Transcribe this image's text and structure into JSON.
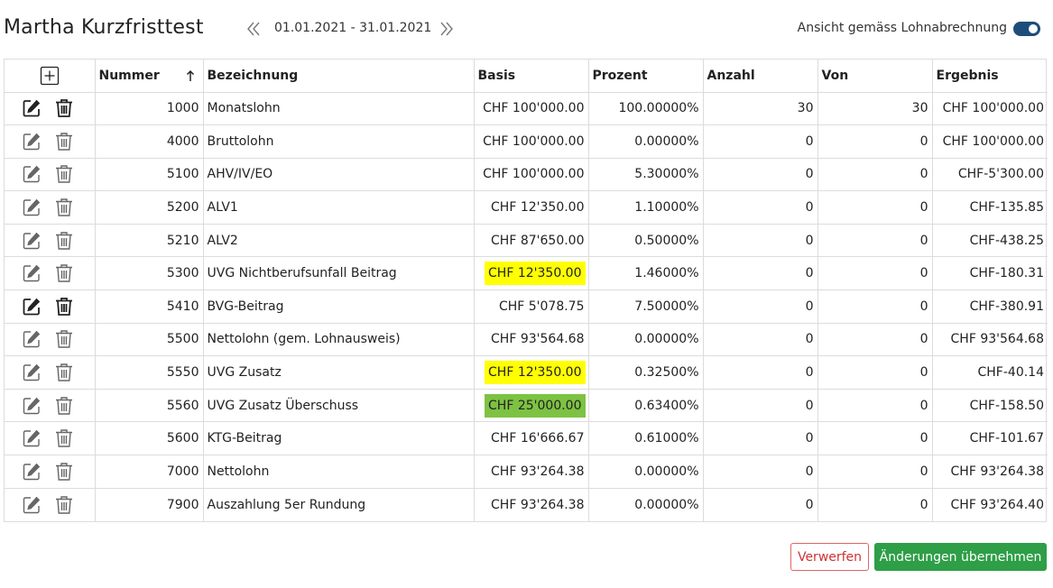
{
  "header": {
    "title": "Martha Kurzfristtest",
    "date_range": "01.01.2021 - 31.01.2021",
    "toggle_label": "Ansicht gemäss Lohnabrechnung",
    "toggle_on": true
  },
  "table": {
    "columns": {
      "nummer": "Nummer",
      "bezeichnung": "Bezeichnung",
      "basis": "Basis",
      "prozent": "Prozent",
      "anzahl": "Anzahl",
      "von": "Von",
      "ergebnis": "Ergebnis"
    },
    "sort": {
      "column": "Nummer",
      "direction": "ascending"
    },
    "rows": [
      {
        "nummer": "1000",
        "bezeichnung": "Monatslohn",
        "basis": "CHF 100'000.00",
        "prozent": "100.00000%",
        "anzahl": "30",
        "von": "30",
        "ergebnis": "CHF 100'000.00",
        "highlight": "",
        "bold_icons": true
      },
      {
        "nummer": "4000",
        "bezeichnung": "Bruttolohn",
        "basis": "CHF 100'000.00",
        "prozent": "0.00000%",
        "anzahl": "0",
        "von": "0",
        "ergebnis": "CHF 100'000.00",
        "highlight": "",
        "bold_icons": false
      },
      {
        "nummer": "5100",
        "bezeichnung": "AHV/IV/EO",
        "basis": "CHF 100'000.00",
        "prozent": "5.30000%",
        "anzahl": "0",
        "von": "0",
        "ergebnis": "CHF-5'300.00",
        "highlight": "",
        "bold_icons": false
      },
      {
        "nummer": "5200",
        "bezeichnung": "ALV1",
        "basis": "CHF 12'350.00",
        "prozent": "1.10000%",
        "anzahl": "0",
        "von": "0",
        "ergebnis": "CHF-135.85",
        "highlight": "",
        "bold_icons": false
      },
      {
        "nummer": "5210",
        "bezeichnung": "ALV2",
        "basis": "CHF 87'650.00",
        "prozent": "0.50000%",
        "anzahl": "0",
        "von": "0",
        "ergebnis": "CHF-438.25",
        "highlight": "",
        "bold_icons": false
      },
      {
        "nummer": "5300",
        "bezeichnung": "UVG Nichtberufsunfall Beitrag",
        "basis": "CHF 12'350.00",
        "prozent": "1.46000%",
        "anzahl": "0",
        "von": "0",
        "ergebnis": "CHF-180.31",
        "highlight": "yellow",
        "bold_icons": false
      },
      {
        "nummer": "5410",
        "bezeichnung": "BVG-Beitrag",
        "basis": "CHF 5'078.75",
        "prozent": "7.50000%",
        "anzahl": "0",
        "von": "0",
        "ergebnis": "CHF-380.91",
        "highlight": "",
        "bold_icons": true
      },
      {
        "nummer": "5500",
        "bezeichnung": "Nettolohn (gem. Lohnausweis)",
        "basis": "CHF 93'564.68",
        "prozent": "0.00000%",
        "anzahl": "0",
        "von": "0",
        "ergebnis": "CHF 93'564.68",
        "highlight": "",
        "bold_icons": false
      },
      {
        "nummer": "5550",
        "bezeichnung": "UVG Zusatz",
        "basis": "CHF 12'350.00",
        "prozent": "0.32500%",
        "anzahl": "0",
        "von": "0",
        "ergebnis": "CHF-40.14",
        "highlight": "yellow",
        "bold_icons": false
      },
      {
        "nummer": "5560",
        "bezeichnung": "UVG Zusatz Überschuss",
        "basis": "CHF 25'000.00",
        "prozent": "0.63400%",
        "anzahl": "0",
        "von": "0",
        "ergebnis": "CHF-158.50",
        "highlight": "green",
        "bold_icons": false
      },
      {
        "nummer": "5600",
        "bezeichnung": "KTG-Beitrag",
        "basis": "CHF 16'666.67",
        "prozent": "0.61000%",
        "anzahl": "0",
        "von": "0",
        "ergebnis": "CHF-101.67",
        "highlight": "",
        "bold_icons": false
      },
      {
        "nummer": "7000",
        "bezeichnung": "Nettolohn",
        "basis": "CHF 93'264.38",
        "prozent": "0.00000%",
        "anzahl": "0",
        "von": "0",
        "ergebnis": "CHF 93'264.38",
        "highlight": "",
        "bold_icons": false
      },
      {
        "nummer": "7900",
        "bezeichnung": "Auszahlung 5er Rundung",
        "basis": "CHF 93'264.38",
        "prozent": "0.00000%",
        "anzahl": "0",
        "von": "0",
        "ergebnis": "CHF 93'264.40",
        "highlight": "",
        "bold_icons": false
      }
    ]
  },
  "icons": {
    "add": "plus-square-icon",
    "edit": "edit-icon",
    "delete": "trash-icon",
    "prev": "double-chevron-left-icon",
    "next": "double-chevron-right-icon",
    "sort": "arrow-up-icon"
  },
  "buttons": {
    "discard": "Verwerfen",
    "apply": "Änderungen übernehmen"
  },
  "colors": {
    "highlight_yellow": "#ffff00",
    "highlight_green": "#7dc242",
    "apply_button": "#2e9e47",
    "discard_text": "#cc3333",
    "toggle": "#1d4d7a"
  }
}
